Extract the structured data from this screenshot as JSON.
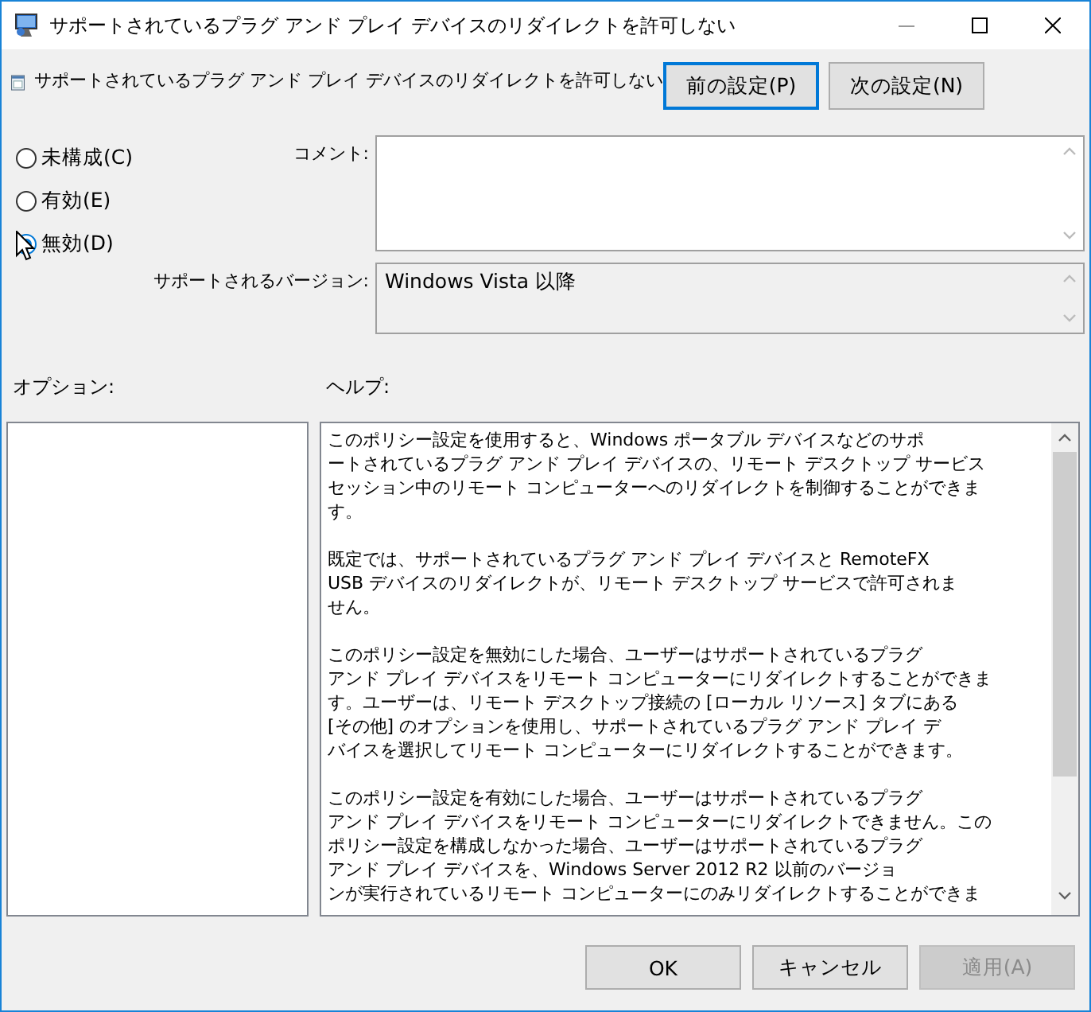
{
  "window": {
    "title": "サポートされているプラグ アンド プレイ デバイスのリダイレクトを許可しない"
  },
  "header": {
    "title": "サポートされているプラグ アンド プレイ デバイスのリダイレクトを許可しない"
  },
  "nav_buttons": [
    {
      "label": "前の設定(P)",
      "focused": true
    },
    {
      "label": "次の設定(N)",
      "focused": false
    }
  ],
  "radios": [
    {
      "label": "未構成(C)",
      "selected": false
    },
    {
      "label": "有効(E)",
      "selected": false
    },
    {
      "label": "無効(D)",
      "selected": true
    }
  ],
  "comment": {
    "label": "コメント:"
  },
  "supported": {
    "label": "サポートされるバージョン:",
    "value": "Windows Vista 以降"
  },
  "options": {
    "label": "オプション:"
  },
  "help": {
    "label": "ヘルプ:",
    "paragraphs": [
      [
        "このポリシー設定を使用すると、Windows ポータブル デバイスなどのサポ",
        "ートされているプラグ アンド プレイ デバイスの、リモート デスクトップ サービス",
        "セッション中のリモート コンピューターへのリダイレクトを制御することができま",
        "す。"
      ],
      [
        "既定では、サポートされているプラグ アンド プレイ デバイスと RemoteFX",
        "USB デバイスのリダイレクトが、リモート デスクトップ サービスで許可されま",
        "せん。"
      ],
      [
        "このポリシー設定を無効にした場合、ユーザーはサポートされているプラグ",
        "アンド プレイ デバイスをリモート コンピューターにリダイレクトすることができま",
        "す。ユーザーは、リモート デスクトップ接続の [ローカル リソース] タブにある",
        "[その他] のオプションを使用し、サポートされているプラグ アンド プレイ デ",
        "バイスを選択してリモート コンピューターにリダイレクトすることができます。"
      ],
      [
        "このポリシー設定を有効にした場合、ユーザーはサポートされているプラグ",
        "アンド プレイ デバイスをリモート コンピューターにリダイレクトできません。この",
        "ポリシー設定を構成しなかった場合、ユーザーはサポートされているプラグ",
        "アンド プレイ デバイスを、Windows Server 2012 R2 以前のバージョ",
        "ンが実行されているリモート コンピューターにのみリダイレクトすることができま"
      ]
    ]
  },
  "buttons": [
    {
      "label": "OK",
      "disabled": false
    },
    {
      "label": "キャンセル",
      "disabled": false
    },
    {
      "label": "適用(A)",
      "disabled": true
    }
  ]
}
